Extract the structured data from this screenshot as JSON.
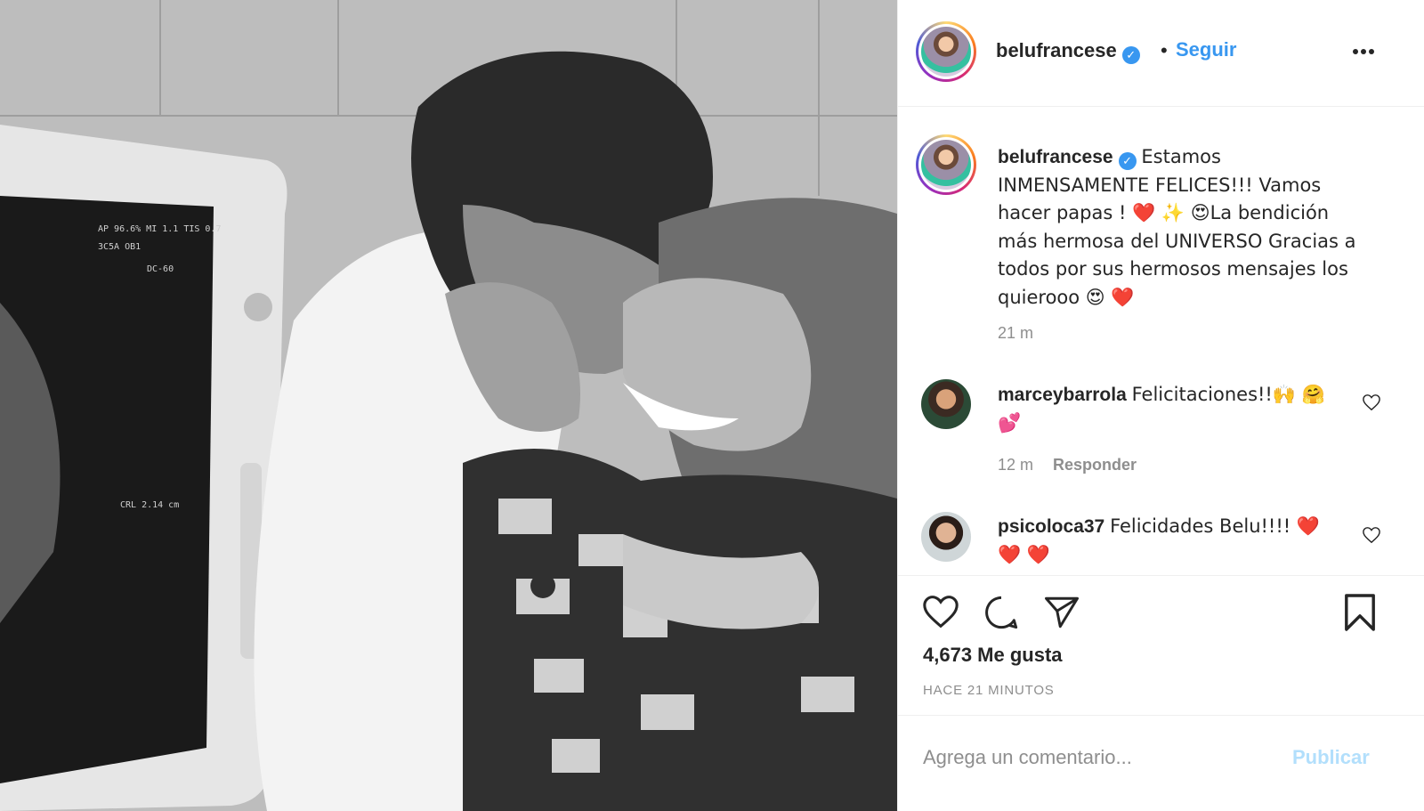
{
  "post": {
    "username": "belufrancese",
    "dot": "•",
    "follow_label": "Seguir",
    "verified_icon": "verified-badge-icon",
    "caption": "Estamos INMENSAMENTE FELICES!!! Vamos hacer papas ! ❤️ ✨ 😍La bendición más hermosa del UNIVERSO Gracias a todos por sus hermosos mensajes los quierooo 😍 ❤️",
    "time": "21 m"
  },
  "comments": [
    {
      "username": "marceybarrola",
      "text": "Felicitaciones!!🙌 🤗 💕",
      "time": "12 m",
      "reply_label": "Responder"
    },
    {
      "username": "psicoloca37",
      "text": "Felicidades Belu!!!! ❤️ ❤️ ❤️"
    }
  ],
  "actions": {
    "likes": "4,673 Me gusta",
    "ago": "HACE 21 MINUTOS",
    "icons": [
      "heart-icon",
      "comment-icon",
      "share-icon",
      "bookmark-icon"
    ]
  },
  "composer": {
    "placeholder": "Agrega un comentario...",
    "publish_label": "Publicar"
  },
  "colors": {
    "accent": "#3897f0",
    "publish_disabled": "#b2dffc",
    "text": "#262626",
    "muted": "#8e8e8e"
  }
}
